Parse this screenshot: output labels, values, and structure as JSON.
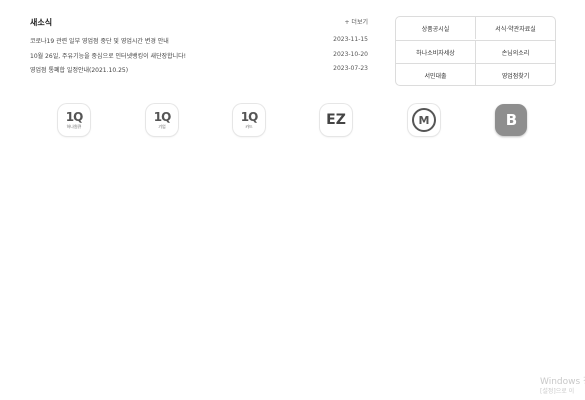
{
  "news": {
    "title": "새소식",
    "more_label": "+ 더보기",
    "items": [
      {
        "text": "코로나19 관련 일부 영업점 중단 및 영업시간 변경 안내",
        "date": "2023-11-15"
      },
      {
        "text": "10월 26일, 주유기능을 중심으로 인터넷뱅킹이 새단장합니다!",
        "date": "2023-10-20"
      },
      {
        "text": "영업점 통폐합 일정안내(2021.10.25)",
        "date": "2023-07-23"
      }
    ]
  },
  "quick_links": [
    {
      "label": "상품공시실"
    },
    {
      "label": "서식·약관자료실"
    },
    {
      "label": "하나소비자세상"
    },
    {
      "label": "손님의소리"
    },
    {
      "label": "서민대출"
    },
    {
      "label": "영업점찾기"
    }
  ],
  "apps": [
    {
      "logo": "1Q",
      "label": "하나원큐",
      "icon": "hana-1q-icon"
    },
    {
      "logo": "1Q",
      "label": "기업",
      "icon": "hana-1q-corporate-icon"
    },
    {
      "logo": "1Q",
      "label": "카드",
      "icon": "hana-1q-card-icon"
    },
    {
      "logo": "EZ",
      "label": "",
      "icon": "ez-app-icon"
    },
    {
      "logo": "M",
      "label": "",
      "icon": "money-app-icon"
    },
    {
      "logo": "B",
      "label": "",
      "icon": "b-app-icon"
    }
  ],
  "watermark": {
    "line1": "Windows 정",
    "line2": "[설정]으로 이"
  }
}
